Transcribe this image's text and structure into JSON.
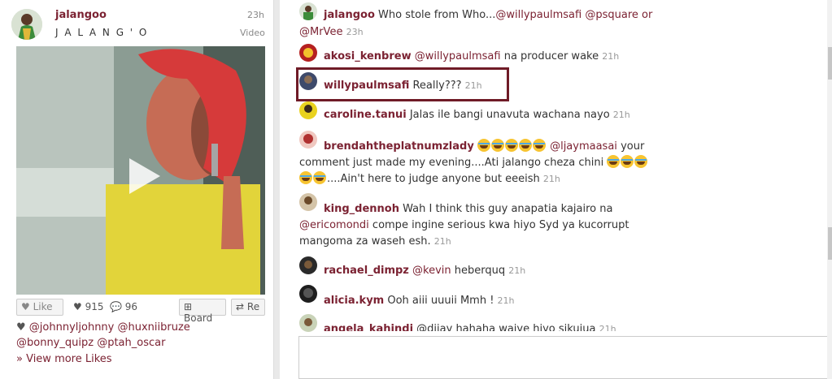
{
  "post": {
    "username": "jalangoo",
    "full_name": "J A L A N G ' O",
    "time": "23h",
    "type": "Video",
    "like_label": "Like",
    "likes_count": "915",
    "comments_count": "96",
    "board_label": "Board",
    "repost_label": "Re",
    "liked_by_line1": "@johnnyljohnny  @huxniibruze",
    "liked_by_line2": "@bonny_quipz  @ptah_oscar",
    "view_more": "» View more Likes"
  },
  "comments": [
    {
      "user": "jalangoo",
      "text": "Who stole from Who...",
      "mentions": "@willypaulmsafi @psquare or",
      "line2_mention": "@MrVee",
      "time": "23h"
    },
    {
      "user": "akosi_kenbrew",
      "mention": "@willypaulmsafi",
      "text": "na producer wake",
      "time": "21h"
    },
    {
      "user": "willypaulmsafi",
      "text": "Really???",
      "time": "21h"
    },
    {
      "user": "caroline.tanui",
      "text": "Jalas ile bangi unavuta wachana nayo",
      "time": "21h"
    },
    {
      "user": "brendahtheplatnumzlady",
      "mention": "@ljaymaasai",
      "text1": "your",
      "text2": "comment just made my evening....Ati jalango cheza chini",
      "text3": "....Ain't here to judge anyone but eeeish",
      "time": "21h"
    },
    {
      "user": "king_dennoh",
      "text1": "Wah I think this guy anapatia kajairo na",
      "mention": "@ericomondi",
      "text2": "compe ingine serious kwa hiyo Syd ya kucorrupt",
      "text3": "mangoma za waseh esh.",
      "time": "21h"
    },
    {
      "user": "rachael_dimpz",
      "mention": "@kevin",
      "text": "heberquq",
      "time": "21h"
    },
    {
      "user": "alicia.kym",
      "text": "Ooh aiii uuuii Mmh !",
      "time": "21h"
    },
    {
      "user": "angela_kahindi",
      "text": "@dijay hahaha waiye hiyo sikujua",
      "time": "21h"
    }
  ]
}
